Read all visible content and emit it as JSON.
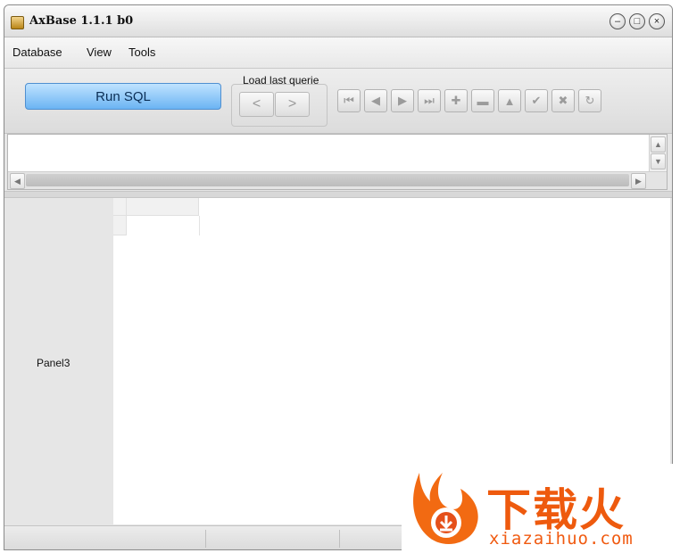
{
  "window": {
    "title": "AxBase 1.1.1  b0"
  },
  "window_controls": {
    "minimize": "–",
    "maximize": "□",
    "close": "×"
  },
  "menu": {
    "items": [
      "Database",
      "View",
      "Tools"
    ]
  },
  "toolbar": {
    "run_sql_label": "Run SQL",
    "load_last_group_label": "Load last querie",
    "prev_label": "<",
    "next_label": ">",
    "nav_icons": [
      "first-record-icon",
      "prior-record-icon",
      "next-record-icon",
      "last-record-icon",
      "insert-icon",
      "delete-icon",
      "edit-icon",
      "post-icon",
      "cancel-icon",
      "refresh-icon"
    ],
    "nav_glyphs": [
      "⏮",
      "◀",
      "▶",
      "⏭",
      "✚",
      "▬",
      "▲",
      "✔",
      "✖",
      "↻"
    ]
  },
  "panel3": {
    "label": "Panel3"
  },
  "watermark": {
    "brand_text": "下载火",
    "url_text": "xiazaihuo.com"
  },
  "colors": {
    "run_button": "#6bb4f3",
    "watermark": "#ee5a0e"
  }
}
